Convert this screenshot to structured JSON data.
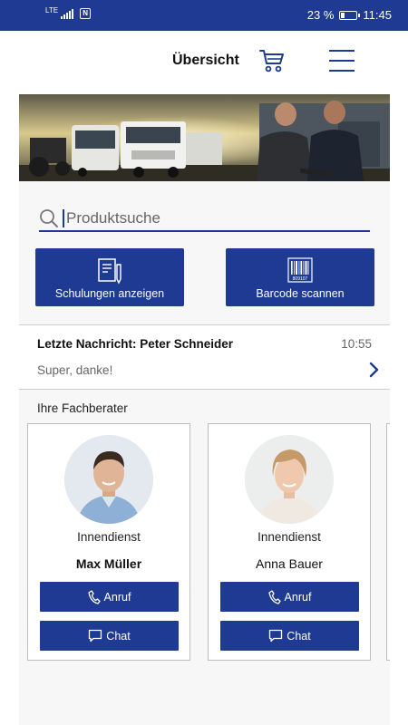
{
  "status_bar": {
    "network": "LTE",
    "battery": "23 %",
    "battery_level": 0.23,
    "time": "11:45"
  },
  "header": {
    "title": "Übersicht",
    "cart_icon": "cart-icon",
    "menu_icon": "hamburger-menu-icon"
  },
  "search": {
    "placeholder": "Produktsuche",
    "value": ""
  },
  "actions": [
    {
      "label": "Schulungen anzeigen",
      "icon": "document-pen-icon"
    },
    {
      "label": "Barcode scannen",
      "icon": "barcode-icon",
      "barcode_digits": "809107"
    }
  ],
  "last_message": {
    "title": "Letzte Nachricht: Peter Schneider",
    "time": "10:55",
    "text": "Super, danke!"
  },
  "advisors_label": "Ihre Fachberater",
  "advisors": [
    {
      "role": "Innendienst",
      "name": "Max Müller",
      "call_label": "Anruf",
      "chat_label": "Chat"
    },
    {
      "role": "Innendienst",
      "name": "Anna Bauer",
      "call_label": "Anruf",
      "chat_label": "Chat"
    }
  ],
  "colors": {
    "brand_blue": "#1f3a93",
    "page_bg": "#f7f7f7"
  }
}
